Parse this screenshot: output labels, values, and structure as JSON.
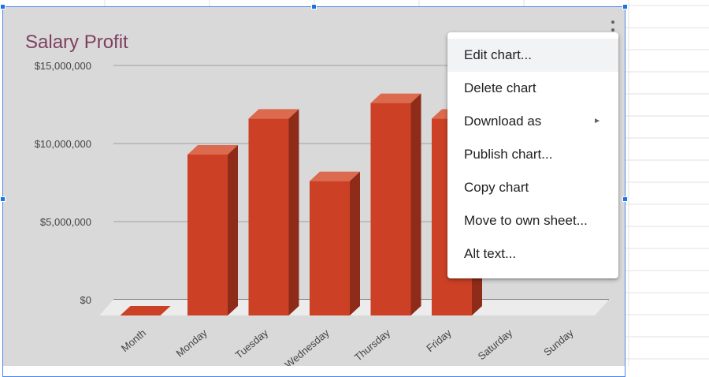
{
  "chart_menu_label": "Chart options",
  "menu": {
    "items": [
      {
        "label": "Edit chart...",
        "highlighted": true
      },
      {
        "label": "Delete chart"
      },
      {
        "label": "Download as",
        "submenu_icon": "triangle-right-icon"
      },
      {
        "label": "Publish chart..."
      },
      {
        "label": "Copy chart"
      },
      {
        "label": "Move to own sheet..."
      },
      {
        "label": "Alt text..."
      }
    ]
  },
  "colors": {
    "bar_front": "#cc4125",
    "bar_top": "#dc6a4e",
    "bar_side": "#8e2b19",
    "title": "#7f3f5e",
    "chart_background": "#d9d9d9",
    "selection": "#1a73e8"
  },
  "chart_data": {
    "type": "bar",
    "style": "3d",
    "title": "Salary Profit",
    "xlabel": "",
    "ylabel": "",
    "categories": [
      "Month",
      "Monday",
      "Tuesday",
      "Wednesday",
      "Thursday",
      "Friday",
      "Saturday",
      "Sunday"
    ],
    "values": [
      0,
      9700000,
      12000000,
      8000000,
      13000000,
      12000000,
      null,
      null
    ],
    "ylim": [
      0,
      15000000
    ],
    "y_ticks": [
      "$0",
      "$5,000,000",
      "$10,000,000",
      "$15,000,000"
    ],
    "y_tick_values": [
      0,
      5000000,
      10000000,
      15000000
    ],
    "grid": true,
    "legend": "none"
  }
}
